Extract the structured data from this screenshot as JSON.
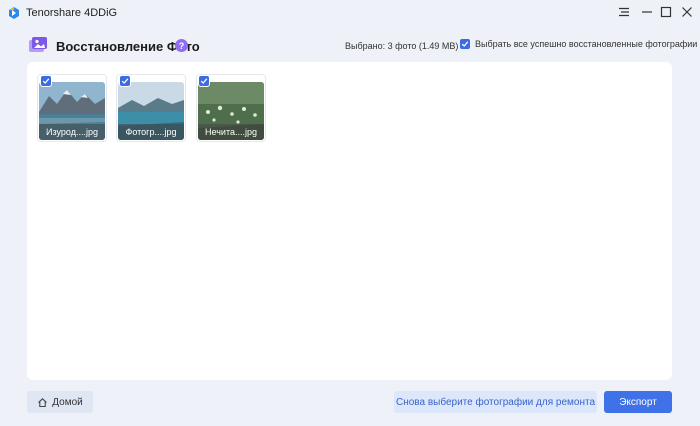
{
  "app": {
    "title": "Tenorshare 4DDiG"
  },
  "header": {
    "title": "Восстановление Фото",
    "help": "?",
    "selected_text": "Выбрано: 3 фото (1.49 MB)",
    "select_all_label": "Выбрать все успешно восстановленные фотографии",
    "select_all_checked": true
  },
  "photos": [
    {
      "caption": "Изурод....jpg",
      "checked": true
    },
    {
      "caption": "Фотогр....jpg",
      "checked": true
    },
    {
      "caption": "Нечита....jpg",
      "checked": true
    }
  ],
  "buttons": {
    "home": "Домой",
    "reselect": "Снова выберите фотографии для ремонта",
    "export": "Экспорт"
  },
  "colors": {
    "accent": "#3f72e8",
    "help_badge": "#8f6ff0",
    "panel": "#ffffff",
    "background": "#eef1f8"
  },
  "icons": {
    "app_logo": "tenorshare-logo-icon",
    "header": "photo-recovery-icon",
    "home": "home-icon"
  }
}
